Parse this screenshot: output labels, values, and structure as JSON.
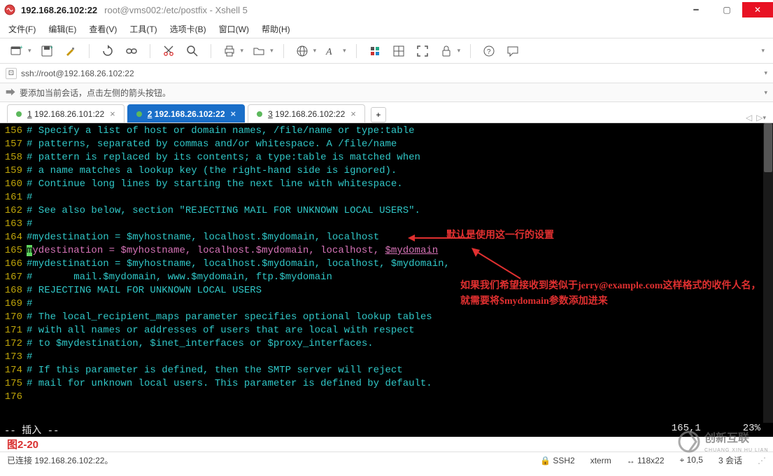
{
  "title": {
    "host": "192.168.26.102:22",
    "path": "root@vms002:/etc/postfix - Xshell 5"
  },
  "menu": {
    "file": "文件(F)",
    "edit": "编辑(E)",
    "view": "查看(V)",
    "tools": "工具(T)",
    "tabs": "选项卡(B)",
    "window": "窗口(W)",
    "help": "帮助(H)"
  },
  "addressbar": {
    "url": "ssh://root@192.168.26.102:22"
  },
  "hintbar": {
    "text": "要添加当前会话，点击左侧的箭头按钮。"
  },
  "tabs": [
    {
      "idx": "1",
      "label": "192.168.26.101:22",
      "active": false
    },
    {
      "idx": "2",
      "label": "192.168.26.102:22",
      "active": true
    },
    {
      "idx": "3",
      "label": "192.168.26.102:22",
      "active": false
    }
  ],
  "terminal": {
    "line_numbers": [
      "156",
      "157",
      "158",
      "159",
      "160",
      "161",
      "162",
      "163",
      "164",
      "165",
      "166",
      "167",
      "168",
      "169",
      "170",
      "171",
      "172",
      "173",
      "174",
      "175",
      "176"
    ],
    "l156": "# Specify a list of host or domain names, /file/name or type:table",
    "l157": "# patterns, separated by commas and/or whitespace. A /file/name",
    "l158": "# pattern is replaced by its contents; a type:table is matched when",
    "l159": "# a name matches a lookup key (the right-hand side is ignored).",
    "l160": "# Continue long lines by starting the next line with whitespace.",
    "l161": "#",
    "l162": "# See also below, section \"REJECTING MAIL FOR UNKNOWN LOCAL USERS\".",
    "l163": "#",
    "l164_a": "#mydestination = ",
    "l164_b": "$myhostname",
    "l164_c": ", localhost.",
    "l164_d": "$mydomain",
    "l164_e": ", localhost",
    "l165_a": "m",
    "l165_b": "ydestination = ",
    "l165_c": "$myhostname",
    "l165_d": ", localhost.",
    "l165_e": "$mydomain",
    "l165_f": ", localhost, ",
    "l165_g": "$mydomain",
    "l166_a": "#mydestination = ",
    "l166_b": "$myhostname",
    "l166_c": ", localhost.",
    "l166_d": "$mydomain",
    "l166_e": ", localhost, ",
    "l166_f": "$mydomain",
    "l166_g": ",",
    "l167_a": "#       mail.",
    "l167_b": "$mydomain",
    "l167_c": ", www.",
    "l167_d": "$mydomain",
    "l167_e": ", ftp.",
    "l167_f": "$mydomain",
    "l168": "",
    "l169": "# REJECTING MAIL FOR UNKNOWN LOCAL USERS",
    "l170": "#",
    "l171": "# The local_recipient_maps parameter specifies optional lookup tables",
    "l172": "# with all names or addresses of users that are local with respect",
    "l173": "# to $mydestination, $inet_interfaces or $proxy_interfaces.",
    "l174": "#",
    "l175": "# If this parameter is defined, then the SMTP server will reject",
    "l176": "# mail for unknown local users. This parameter is defined by default.",
    "vim_mode": "-- 插入 --",
    "vim_pos": "165,1",
    "vim_pct": "23%"
  },
  "annotations": {
    "a1": "默认是使用这一行的设置",
    "a2": "如果我们希望接收到类似于jerry@example.com这样格式的收件人名，就需要将$mydomain参数添加进来"
  },
  "figure": {
    "label": "图2-20"
  },
  "statusbar": {
    "conn": "已连接 192.168.26.102:22。",
    "ssh": "SSH2",
    "term": "xterm",
    "size": "118x22",
    "pos": "10,5",
    "sessions": "3 会话"
  },
  "watermark": {
    "brand": "创新互联",
    "sub": "CHUANG XIN HU LIAN"
  },
  "icons": {
    "terminal_plus": "terminal-plus-icon",
    "save": "save-icon",
    "brush": "brush-icon",
    "refresh": "refresh-icon",
    "link": "link-icon",
    "scissors": "scissors-icon",
    "search": "search-icon",
    "print": "print-icon",
    "folder": "folder-icon",
    "globe": "globe-icon",
    "font": "font-icon",
    "color": "color-icon",
    "grid": "grid-icon",
    "fullscr": "fullscreen-icon",
    "lock": "lock-icon",
    "help": "help-icon",
    "chat": "chat-icon"
  }
}
